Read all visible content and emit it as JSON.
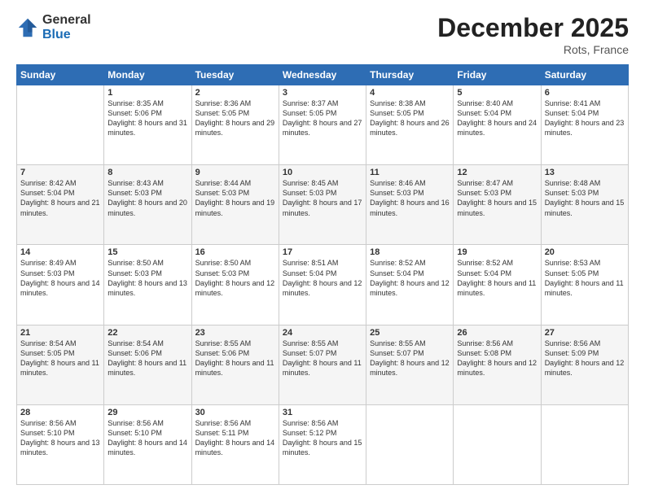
{
  "logo": {
    "general": "General",
    "blue": "Blue"
  },
  "header": {
    "month": "December 2025",
    "location": "Rots, France"
  },
  "weekdays": [
    "Sunday",
    "Monday",
    "Tuesday",
    "Wednesday",
    "Thursday",
    "Friday",
    "Saturday"
  ],
  "weeks": [
    [
      {
        "day": "",
        "sunrise": "",
        "sunset": "",
        "daylight": ""
      },
      {
        "day": "1",
        "sunrise": "Sunrise: 8:35 AM",
        "sunset": "Sunset: 5:06 PM",
        "daylight": "Daylight: 8 hours and 31 minutes."
      },
      {
        "day": "2",
        "sunrise": "Sunrise: 8:36 AM",
        "sunset": "Sunset: 5:05 PM",
        "daylight": "Daylight: 8 hours and 29 minutes."
      },
      {
        "day": "3",
        "sunrise": "Sunrise: 8:37 AM",
        "sunset": "Sunset: 5:05 PM",
        "daylight": "Daylight: 8 hours and 27 minutes."
      },
      {
        "day": "4",
        "sunrise": "Sunrise: 8:38 AM",
        "sunset": "Sunset: 5:05 PM",
        "daylight": "Daylight: 8 hours and 26 minutes."
      },
      {
        "day": "5",
        "sunrise": "Sunrise: 8:40 AM",
        "sunset": "Sunset: 5:04 PM",
        "daylight": "Daylight: 8 hours and 24 minutes."
      },
      {
        "day": "6",
        "sunrise": "Sunrise: 8:41 AM",
        "sunset": "Sunset: 5:04 PM",
        "daylight": "Daylight: 8 hours and 23 minutes."
      }
    ],
    [
      {
        "day": "7",
        "sunrise": "Sunrise: 8:42 AM",
        "sunset": "Sunset: 5:04 PM",
        "daylight": "Daylight: 8 hours and 21 minutes."
      },
      {
        "day": "8",
        "sunrise": "Sunrise: 8:43 AM",
        "sunset": "Sunset: 5:03 PM",
        "daylight": "Daylight: 8 hours and 20 minutes."
      },
      {
        "day": "9",
        "sunrise": "Sunrise: 8:44 AM",
        "sunset": "Sunset: 5:03 PM",
        "daylight": "Daylight: 8 hours and 19 minutes."
      },
      {
        "day": "10",
        "sunrise": "Sunrise: 8:45 AM",
        "sunset": "Sunset: 5:03 PM",
        "daylight": "Daylight: 8 hours and 17 minutes."
      },
      {
        "day": "11",
        "sunrise": "Sunrise: 8:46 AM",
        "sunset": "Sunset: 5:03 PM",
        "daylight": "Daylight: 8 hours and 16 minutes."
      },
      {
        "day": "12",
        "sunrise": "Sunrise: 8:47 AM",
        "sunset": "Sunset: 5:03 PM",
        "daylight": "Daylight: 8 hours and 15 minutes."
      },
      {
        "day": "13",
        "sunrise": "Sunrise: 8:48 AM",
        "sunset": "Sunset: 5:03 PM",
        "daylight": "Daylight: 8 hours and 15 minutes."
      }
    ],
    [
      {
        "day": "14",
        "sunrise": "Sunrise: 8:49 AM",
        "sunset": "Sunset: 5:03 PM",
        "daylight": "Daylight: 8 hours and 14 minutes."
      },
      {
        "day": "15",
        "sunrise": "Sunrise: 8:50 AM",
        "sunset": "Sunset: 5:03 PM",
        "daylight": "Daylight: 8 hours and 13 minutes."
      },
      {
        "day": "16",
        "sunrise": "Sunrise: 8:50 AM",
        "sunset": "Sunset: 5:03 PM",
        "daylight": "Daylight: 8 hours and 12 minutes."
      },
      {
        "day": "17",
        "sunrise": "Sunrise: 8:51 AM",
        "sunset": "Sunset: 5:04 PM",
        "daylight": "Daylight: 8 hours and 12 minutes."
      },
      {
        "day": "18",
        "sunrise": "Sunrise: 8:52 AM",
        "sunset": "Sunset: 5:04 PM",
        "daylight": "Daylight: 8 hours and 12 minutes."
      },
      {
        "day": "19",
        "sunrise": "Sunrise: 8:52 AM",
        "sunset": "Sunset: 5:04 PM",
        "daylight": "Daylight: 8 hours and 11 minutes."
      },
      {
        "day": "20",
        "sunrise": "Sunrise: 8:53 AM",
        "sunset": "Sunset: 5:05 PM",
        "daylight": "Daylight: 8 hours and 11 minutes."
      }
    ],
    [
      {
        "day": "21",
        "sunrise": "Sunrise: 8:54 AM",
        "sunset": "Sunset: 5:05 PM",
        "daylight": "Daylight: 8 hours and 11 minutes."
      },
      {
        "day": "22",
        "sunrise": "Sunrise: 8:54 AM",
        "sunset": "Sunset: 5:06 PM",
        "daylight": "Daylight: 8 hours and 11 minutes."
      },
      {
        "day": "23",
        "sunrise": "Sunrise: 8:55 AM",
        "sunset": "Sunset: 5:06 PM",
        "daylight": "Daylight: 8 hours and 11 minutes."
      },
      {
        "day": "24",
        "sunrise": "Sunrise: 8:55 AM",
        "sunset": "Sunset: 5:07 PM",
        "daylight": "Daylight: 8 hours and 11 minutes."
      },
      {
        "day": "25",
        "sunrise": "Sunrise: 8:55 AM",
        "sunset": "Sunset: 5:07 PM",
        "daylight": "Daylight: 8 hours and 12 minutes."
      },
      {
        "day": "26",
        "sunrise": "Sunrise: 8:56 AM",
        "sunset": "Sunset: 5:08 PM",
        "daylight": "Daylight: 8 hours and 12 minutes."
      },
      {
        "day": "27",
        "sunrise": "Sunrise: 8:56 AM",
        "sunset": "Sunset: 5:09 PM",
        "daylight": "Daylight: 8 hours and 12 minutes."
      }
    ],
    [
      {
        "day": "28",
        "sunrise": "Sunrise: 8:56 AM",
        "sunset": "Sunset: 5:10 PM",
        "daylight": "Daylight: 8 hours and 13 minutes."
      },
      {
        "day": "29",
        "sunrise": "Sunrise: 8:56 AM",
        "sunset": "Sunset: 5:10 PM",
        "daylight": "Daylight: 8 hours and 14 minutes."
      },
      {
        "day": "30",
        "sunrise": "Sunrise: 8:56 AM",
        "sunset": "Sunset: 5:11 PM",
        "daylight": "Daylight: 8 hours and 14 minutes."
      },
      {
        "day": "31",
        "sunrise": "Sunrise: 8:56 AM",
        "sunset": "Sunset: 5:12 PM",
        "daylight": "Daylight: 8 hours and 15 minutes."
      },
      {
        "day": "",
        "sunrise": "",
        "sunset": "",
        "daylight": ""
      },
      {
        "day": "",
        "sunrise": "",
        "sunset": "",
        "daylight": ""
      },
      {
        "day": "",
        "sunrise": "",
        "sunset": "",
        "daylight": ""
      }
    ]
  ]
}
